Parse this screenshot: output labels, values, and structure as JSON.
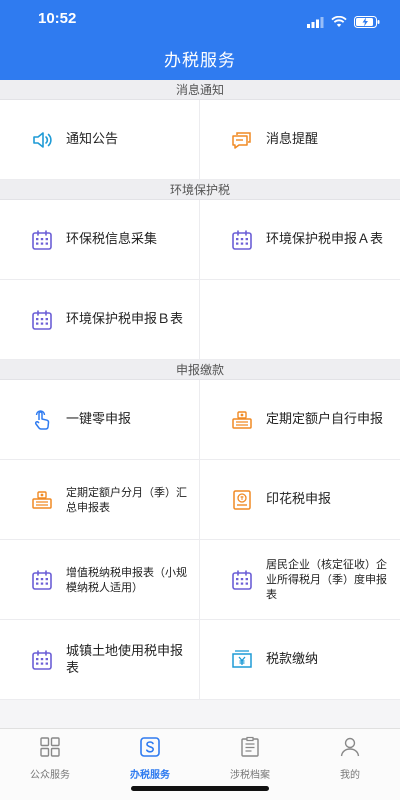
{
  "status_bar": {
    "time": "10:52"
  },
  "header": {
    "title": "办税服务"
  },
  "sections": [
    {
      "title": "消息通知",
      "items": [
        {
          "label": "通知公告",
          "icon": "speaker-icon"
        },
        {
          "label": "消息提醒",
          "icon": "chat-bubble-icon"
        }
      ]
    },
    {
      "title": "环境保护税",
      "items": [
        {
          "label": "环保税信息采集",
          "icon": "calendar-icon"
        },
        {
          "label": "环境保护税申报Ａ表",
          "icon": "calendar-icon"
        },
        {
          "label": "环境保护税申报Ｂ表",
          "icon": "calendar-icon"
        }
      ]
    },
    {
      "title": "申报缴款",
      "items": [
        {
          "label": "一键零申报",
          "icon": "tap-hand-icon"
        },
        {
          "label": "定期定额户自行申报",
          "icon": "cash-register-icon"
        },
        {
          "label": "定期定额户分月（季）汇总申报表",
          "icon": "cash-register-icon"
        },
        {
          "label": "印花税申报",
          "icon": "stamp-icon"
        },
        {
          "label": "增值税纳税申报表（小规模纳税人适用）",
          "icon": "calendar-icon"
        },
        {
          "label": "居民企业（核定征收）企业所得税月（季）度申报表",
          "icon": "calendar-icon"
        },
        {
          "label": "城镇土地使用税申报表",
          "icon": "calendar-icon"
        },
        {
          "label": "税款缴纳",
          "icon": "yen-payment-icon"
        }
      ]
    }
  ],
  "tabbar": [
    {
      "label": "公众服务",
      "icon": "grid-icon",
      "active": false
    },
    {
      "label": "办税服务",
      "icon": "s-badge-icon",
      "active": true
    },
    {
      "label": "涉税档案",
      "icon": "archive-icon",
      "active": false
    },
    {
      "label": "我的",
      "icon": "person-icon",
      "active": false
    }
  ],
  "colors": {
    "header_blue": "#2f7bf0",
    "icon_blue": "#2f7bf0",
    "icon_orange": "#f08a24",
    "icon_purple": "#6c5fd6",
    "icon_teal": "#1f9bd6"
  }
}
